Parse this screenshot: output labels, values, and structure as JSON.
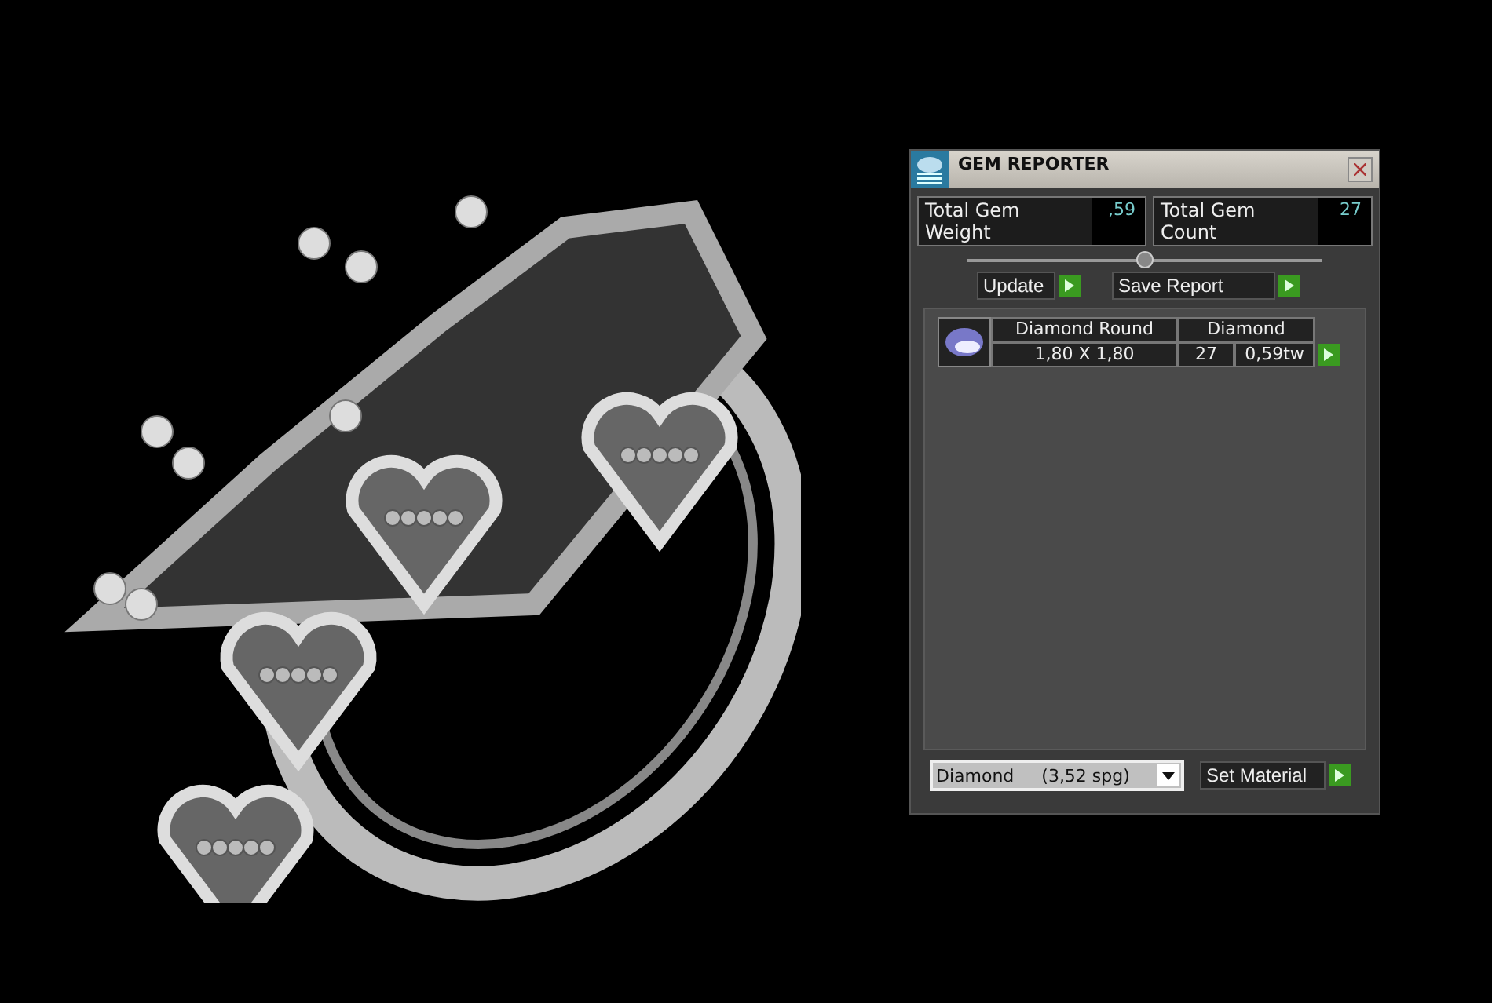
{
  "window": {
    "title": "GEM REPORTER"
  },
  "totals": [
    {
      "label": "Total Gem Weight",
      "value": ",59"
    },
    {
      "label": "Total Gem Count",
      "value": "27"
    }
  ],
  "slider": {
    "level": 0.5
  },
  "buttons": [
    {
      "label": "Update"
    },
    {
      "label": "Save Report"
    }
  ],
  "gems": [
    {
      "name": "Diamond Round",
      "material": "Diamond",
      "size": "1,80 X 1,80",
      "count": "27",
      "weight": "0,59tw"
    }
  ],
  "material_select": {
    "value": "Diamond     (3,52 spg)"
  },
  "set_button": {
    "label": "Set Material"
  }
}
